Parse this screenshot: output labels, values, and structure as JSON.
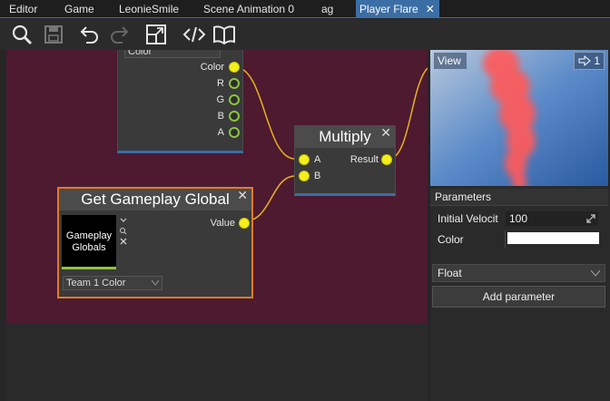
{
  "tabs": [
    {
      "label": "Editor"
    },
    {
      "label": "Game"
    },
    {
      "label": "LeonieSmile"
    },
    {
      "label": "Scene Animation 0"
    },
    {
      "label": "ag"
    },
    {
      "label": "Player Flare",
      "close": "✕"
    }
  ],
  "toolbar": {
    "icons": [
      "search-icon",
      "save-icon",
      "undo-icon",
      "redo-icon",
      "fit-view-icon",
      "code-icon",
      "docs-icon"
    ]
  },
  "nodes": {
    "color_node": {
      "dropdown_value": "Color",
      "outputs": [
        "Color",
        "R",
        "G",
        "B",
        "A"
      ]
    },
    "multiply": {
      "title": "Multiply",
      "inputs": [
        "A",
        "B"
      ],
      "output": "Result",
      "close": "✕"
    },
    "get_global": {
      "title": "Get Gameplay Global",
      "close": "✕",
      "thumbnail_line1": "Gameplay",
      "thumbnail_line2": "Globals",
      "output": "Value",
      "dropdown_value": "Team 1 Color"
    }
  },
  "preview": {
    "label": "View",
    "badge": "1"
  },
  "parameters": {
    "header": "Parameters",
    "rows": [
      {
        "label": "Initial Velocit",
        "value": "100"
      },
      {
        "label": "Color",
        "value": ""
      }
    ],
    "type_select": "Float",
    "add_button": "Add parameter"
  },
  "colors": {
    "accent": "#3b6ea5",
    "canvas": "#4d1a30",
    "pin_yellow": "#f5ef1b",
    "pin_green": "#8cc63f",
    "wire": "#e8b020",
    "orange_border": "#e07a2a"
  }
}
